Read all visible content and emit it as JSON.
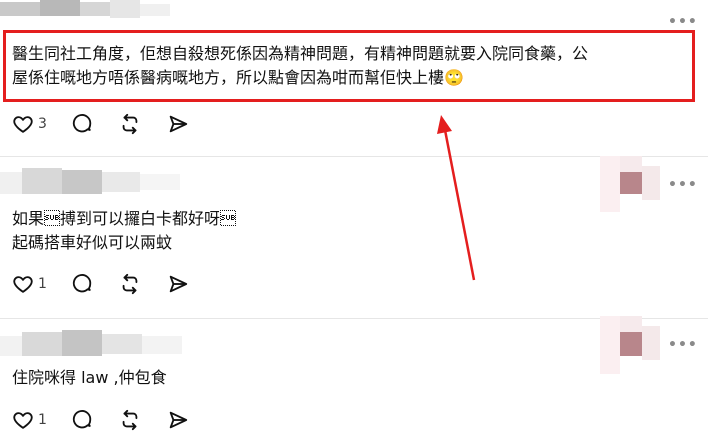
{
  "posts": [
    {
      "text_lines": [
        "醫生同社工角度，佢想自殺想死係因為精神問題，有精神問題就要入院同食藥，公",
        "屋係住嘅地方唔係醫病嘅地方，所以點會因為咁而幫佢快上樓"
      ],
      "emoji": "🙄",
      "like_count": "3"
    },
    {
      "text_lines": [
        "如果\u001a搏到可以攞白卡都好呀\u001a",
        "起碼搭車好似可以兩蚊"
      ],
      "like_count": "1"
    },
    {
      "text_lines": [
        "住院咪得 law ,仲包食"
      ],
      "like_count": "1"
    }
  ],
  "icons": {
    "like": "heart-icon",
    "reply": "comment-bubble-icon",
    "repost": "repost-icon",
    "share": "send-icon",
    "more": "more-dots-icon"
  },
  "annotation_color": "#e41e1e",
  "more_glyph": "•••"
}
